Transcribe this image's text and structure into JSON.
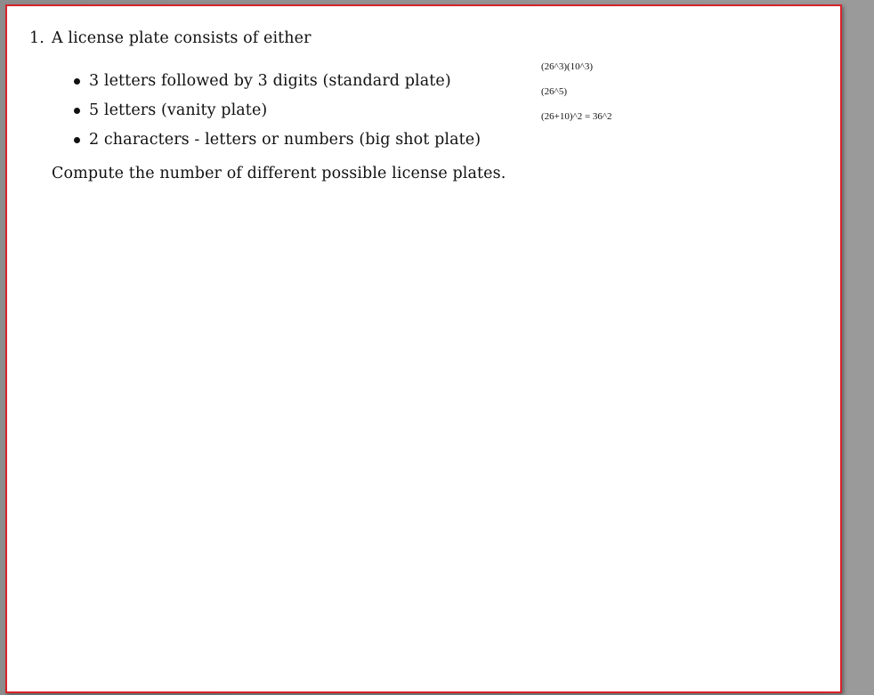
{
  "problem": {
    "number": "1.",
    "intro": "A license plate consists of either",
    "options": [
      "3 letters followed by 3 digits (standard plate)",
      "5 letters (vanity plate)",
      "2 characters - letters or numbers (big shot plate)"
    ],
    "question": "Compute the number of different possible license plates."
  },
  "annotations": [
    "(26^3)(10^3)",
    "(26^5)",
    "(26+10)^2 = 36^2"
  ],
  "colors": {
    "page_border": "#d8232a",
    "background": "#8f8f8f"
  }
}
